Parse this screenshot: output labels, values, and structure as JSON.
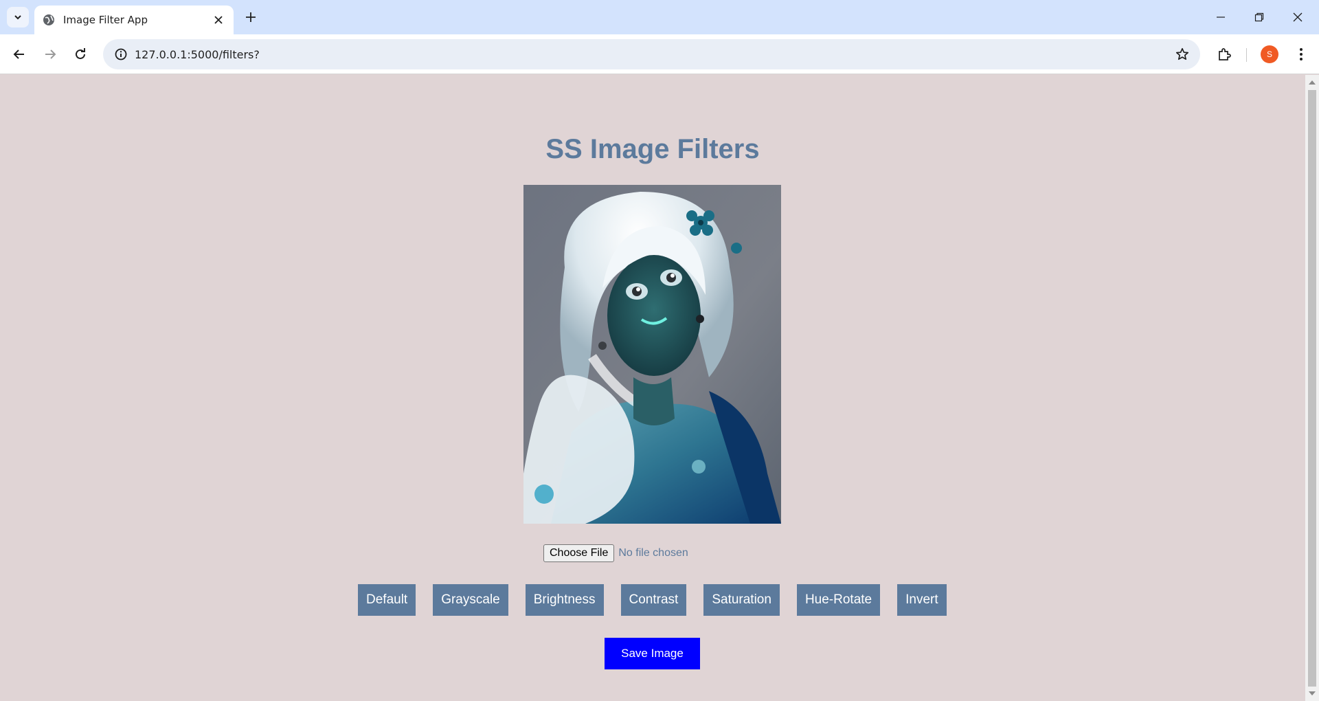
{
  "browser": {
    "tab_title": "Image Filter App",
    "url": "127.0.0.1:5000/filters?",
    "profile_initial": "S"
  },
  "page": {
    "title": "SS Image Filters",
    "image_alt": "inverted-color illustration of a girl with white hair",
    "file_input": {
      "button_label": "Choose File",
      "status": "No file chosen"
    },
    "filters": [
      {
        "label": "Default"
      },
      {
        "label": "Grayscale"
      },
      {
        "label": "Brightness"
      },
      {
        "label": "Contrast"
      },
      {
        "label": "Saturation"
      },
      {
        "label": "Hue-Rotate"
      },
      {
        "label": "Invert"
      }
    ],
    "save_label": "Save Image"
  },
  "colors": {
    "page_background": "#e0d4d5",
    "accent": "#5c7a9c",
    "save_button": "#0000ff"
  }
}
